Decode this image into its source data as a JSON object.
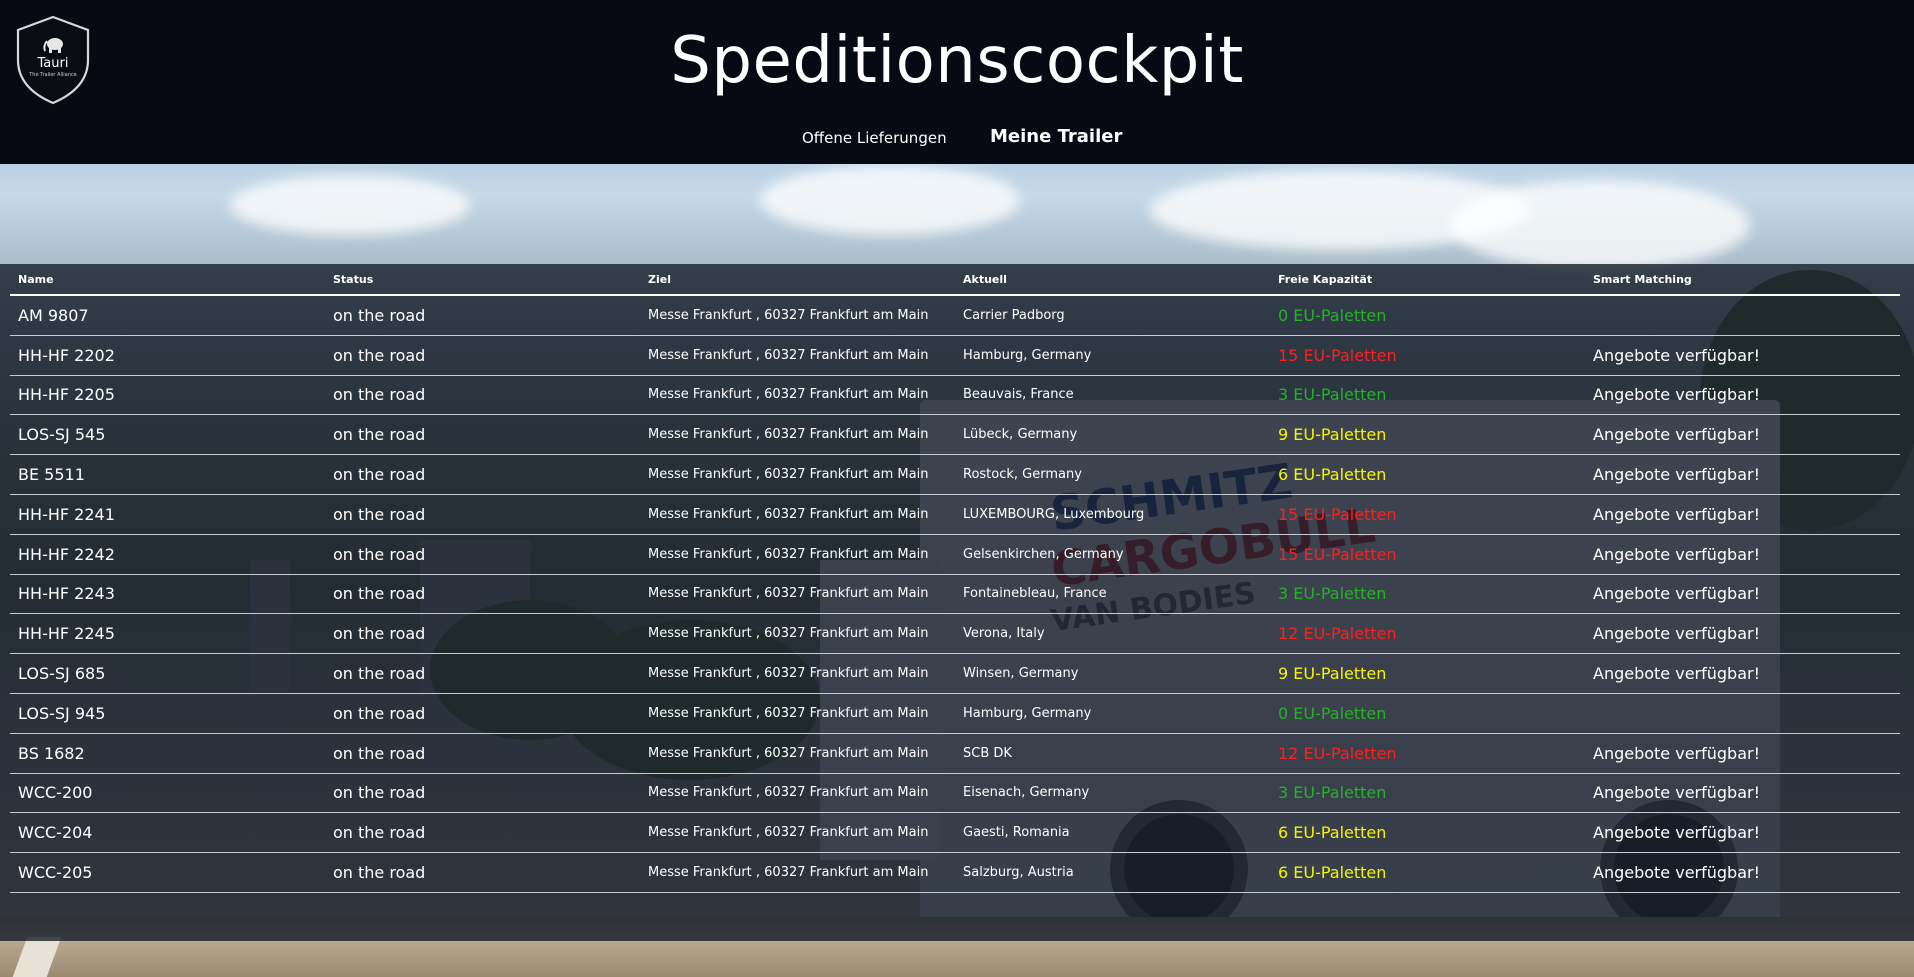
{
  "app": {
    "title": "Speditionscockpit",
    "logo": {
      "name": "Tauri",
      "tagline": "The Trailer Alliance",
      "icon": "elephant-icon"
    }
  },
  "nav": {
    "items": [
      {
        "label": "Offene Lieferungen",
        "active": false
      },
      {
        "label": "Meine Trailer",
        "active": true
      }
    ]
  },
  "colors": {
    "header_bg": "#070913",
    "capacity_green": "#23b323",
    "capacity_red": "#ff1f1f",
    "capacity_yellow": "#f6f600"
  },
  "table": {
    "columns": [
      "Name",
      "Status",
      "Ziel",
      "Aktuell",
      "Freie Kapazität",
      "Smart Matching"
    ],
    "rows": [
      {
        "name": "AM 9807",
        "status": "on the road",
        "ziel": "Messe Frankfurt , 60327 Frankfurt am Main",
        "aktuell": "Carrier Padborg",
        "capacity": "0 EU-Paletten",
        "capacity_level": "green",
        "match": ""
      },
      {
        "name": "HH-HF 2202",
        "status": "on the road",
        "ziel": "Messe Frankfurt , 60327 Frankfurt am Main",
        "aktuell": "Hamburg, Germany",
        "capacity": "15 EU-Paletten",
        "capacity_level": "red",
        "match": "Angebote verfügbar!"
      },
      {
        "name": "HH-HF 2205",
        "status": "on the road",
        "ziel": "Messe Frankfurt , 60327 Frankfurt am Main",
        "aktuell": "Beauvais, France",
        "capacity": "3 EU-Paletten",
        "capacity_level": "green",
        "match": "Angebote verfügbar!"
      },
      {
        "name": "LOS-SJ 545",
        "status": "on the road",
        "ziel": "Messe Frankfurt , 60327 Frankfurt am Main",
        "aktuell": "Lübeck, Germany",
        "capacity": "9 EU-Paletten",
        "capacity_level": "yellow",
        "match": "Angebote verfügbar!"
      },
      {
        "name": "BE 5511",
        "status": "on the road",
        "ziel": "Messe Frankfurt , 60327 Frankfurt am Main",
        "aktuell": "Rostock, Germany",
        "capacity": "6 EU-Paletten",
        "capacity_level": "yellow",
        "match": "Angebote verfügbar!"
      },
      {
        "name": "HH-HF 2241",
        "status": "on the road",
        "ziel": "Messe Frankfurt , 60327 Frankfurt am Main",
        "aktuell": "LUXEMBOURG, Luxembourg",
        "capacity": "15 EU-Paletten",
        "capacity_level": "red",
        "match": "Angebote verfügbar!"
      },
      {
        "name": "HH-HF 2242",
        "status": "on the road",
        "ziel": "Messe Frankfurt , 60327 Frankfurt am Main",
        "aktuell": "Gelsenkirchen, Germany",
        "capacity": "15 EU-Paletten",
        "capacity_level": "red",
        "match": "Angebote verfügbar!"
      },
      {
        "name": "HH-HF 2243",
        "status": "on the road",
        "ziel": "Messe Frankfurt , 60327 Frankfurt am Main",
        "aktuell": "Fontainebleau, France",
        "capacity": "3 EU-Paletten",
        "capacity_level": "green",
        "match": "Angebote verfügbar!"
      },
      {
        "name": "HH-HF 2245",
        "status": "on the road",
        "ziel": "Messe Frankfurt , 60327 Frankfurt am Main",
        "aktuell": "Verona, Italy",
        "capacity": "12 EU-Paletten",
        "capacity_level": "red",
        "match": "Angebote verfügbar!"
      },
      {
        "name": "LOS-SJ 685",
        "status": "on the road",
        "ziel": "Messe Frankfurt , 60327 Frankfurt am Main",
        "aktuell": "Winsen, Germany",
        "capacity": "9 EU-Paletten",
        "capacity_level": "yellow",
        "match": "Angebote verfügbar!"
      },
      {
        "name": "LOS-SJ 945",
        "status": "on the road",
        "ziel": "Messe Frankfurt , 60327 Frankfurt am Main",
        "aktuell": "Hamburg, Germany",
        "capacity": "0 EU-Paletten",
        "capacity_level": "green",
        "match": ""
      },
      {
        "name": "BS 1682",
        "status": "on the road",
        "ziel": "Messe Frankfurt , 60327 Frankfurt am Main",
        "aktuell": "SCB DK",
        "capacity": "12 EU-Paletten",
        "capacity_level": "red",
        "match": "Angebote verfügbar!"
      },
      {
        "name": "WCC-200",
        "status": "on the road",
        "ziel": "Messe Frankfurt , 60327 Frankfurt am Main",
        "aktuell": "Eisenach, Germany",
        "capacity": "3 EU-Paletten",
        "capacity_level": "green",
        "match": "Angebote verfügbar!"
      },
      {
        "name": "WCC-204",
        "status": "on the road",
        "ziel": "Messe Frankfurt , 60327 Frankfurt am Main",
        "aktuell": "Gaesti, Romania",
        "capacity": "6 EU-Paletten",
        "capacity_level": "yellow",
        "match": "Angebote verfügbar!"
      },
      {
        "name": "WCC-205",
        "status": "on the road",
        "ziel": "Messe Frankfurt , 60327 Frankfurt am Main",
        "aktuell": "Salzburg, Austria",
        "capacity": "6 EU-Paletten",
        "capacity_level": "yellow",
        "match": "Angebote verfügbar!"
      }
    ]
  }
}
